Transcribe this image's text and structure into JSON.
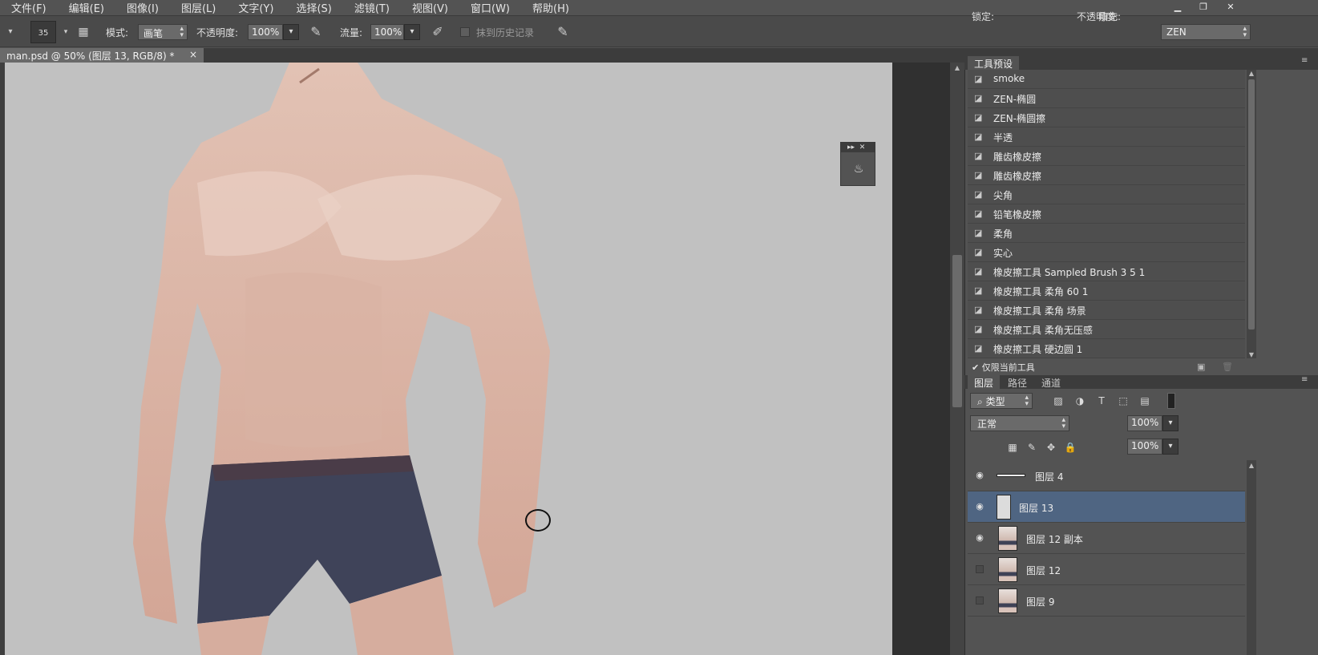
{
  "menubar": {
    "items": [
      "文件(F)",
      "编辑(E)",
      "图像(I)",
      "图层(L)",
      "文字(Y)",
      "选择(S)",
      "滤镜(T)",
      "视图(V)",
      "窗口(W)",
      "帮助(H)"
    ]
  },
  "options": {
    "brush_size": "35",
    "mode_label": "模式:",
    "mode_value": "画笔",
    "opacity_label": "不透明度:",
    "opacity_value": "100%",
    "flow_label": "流量:",
    "flow_value": "100%",
    "history_label": "抹到历史记录",
    "workspace_value": "ZEN"
  },
  "document": {
    "tab_title": "man.psd @ 50% (图层 13, RGB/8) *",
    "close": "×"
  },
  "tool_presets": {
    "tab_label": "工具预设",
    "items": [
      "smoke",
      "ZEN-椭圆",
      "ZEN-椭圆擦",
      "半透",
      "雕齿橡皮擦",
      "雕齿橡皮擦",
      "尖角",
      "铅笔橡皮擦",
      "柔角",
      "实心",
      "橡皮擦工具 Sampled Brush 3 5 1",
      "橡皮擦工具 柔角 60 1",
      "橡皮擦工具 柔角 场景",
      "橡皮擦工具 柔角无压感",
      "橡皮擦工具 硬边圆 1"
    ],
    "current_only_label": "仅限当前工具"
  },
  "layers_panel": {
    "tabs": [
      "图层",
      "路径",
      "通道"
    ],
    "filter_label": "类型",
    "blend_mode": "正常",
    "opacity_label": "不透明度:",
    "opacity_value": "100%",
    "lock_label": "锁定:",
    "fill_label": "填充:",
    "fill_value": "100%",
    "layers": [
      {
        "name": "图层 4",
        "visible": true,
        "selected": false
      },
      {
        "name": "图层 13",
        "visible": true,
        "selected": true
      },
      {
        "name": "图层 12 副本",
        "visible": true,
        "selected": false
      },
      {
        "name": "图层 12",
        "visible": false,
        "selected": false
      },
      {
        "name": "图层 9",
        "visible": false,
        "selected": false
      }
    ]
  },
  "colors": {
    "ui_bg": "#535353",
    "canvas_bg": "#c1c1c1",
    "selected_layer": "#4f6582"
  }
}
